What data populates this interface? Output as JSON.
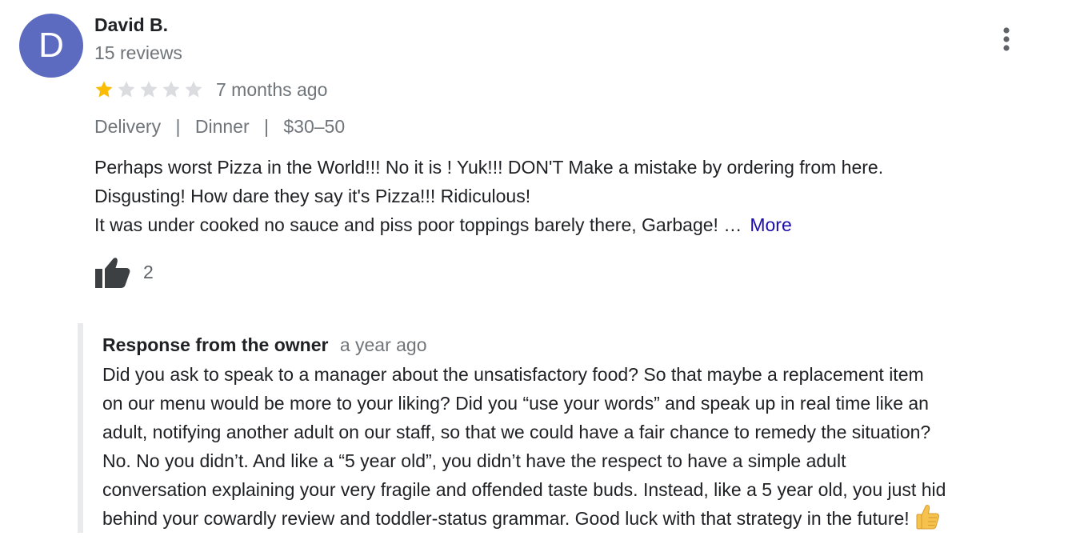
{
  "review": {
    "avatar_letter": "D",
    "author_name": "David B.",
    "review_count": "15 reviews",
    "rating": 1,
    "rating_max": 5,
    "time": "7 months ago",
    "tags": [
      "Delivery",
      "Dinner",
      "$30–50"
    ],
    "tag_separator": "|",
    "text_lines": [
      "Perhaps worst Pizza in the World!!! No it is ! Yuk!!! DON'T Make a mistake by ordering from here.",
      "Disgusting! How dare they say it's Pizza!!! Ridiculous!",
      "It was under cooked no sauce and piss poor toppings barely there, Garbage! …"
    ],
    "more_label": "More",
    "like_count": "2"
  },
  "owner_response": {
    "title": "Response from the owner",
    "time": "a year ago",
    "text_lines": [
      "Did you ask to speak to a manager about the unsatisfactory food? So that maybe a replacement item",
      "on our menu would be more to your liking? Did you “use your words” and speak up in real time like an",
      "adult, notifying another adult on our staff, so that we could have a fair chance to remedy the situation?",
      "No. No you didn’t. And like a “5 year old”, you didn’t have the respect to have a simple adult",
      "conversation explaining your very fragile and offended taste buds. Instead, like a 5 year old, you just hid",
      "behind your cowardly review and toddler-status grammar. Good luck with that strategy in the future!"
    ]
  },
  "icons": {
    "more_options": "more-vertical-icon",
    "like": "thumbs-up-icon",
    "star_filled": "star-filled-icon",
    "star_empty": "star-empty-icon",
    "emoji": "thumbs-up-emoji-icon"
  },
  "colors": {
    "avatar_bg": "#5c6bc0",
    "star_filled": "#fbbc04",
    "star_empty": "#dadce0",
    "link": "#1a0dab",
    "secondary_text": "#70757a",
    "response_border": "#e8eaed"
  }
}
